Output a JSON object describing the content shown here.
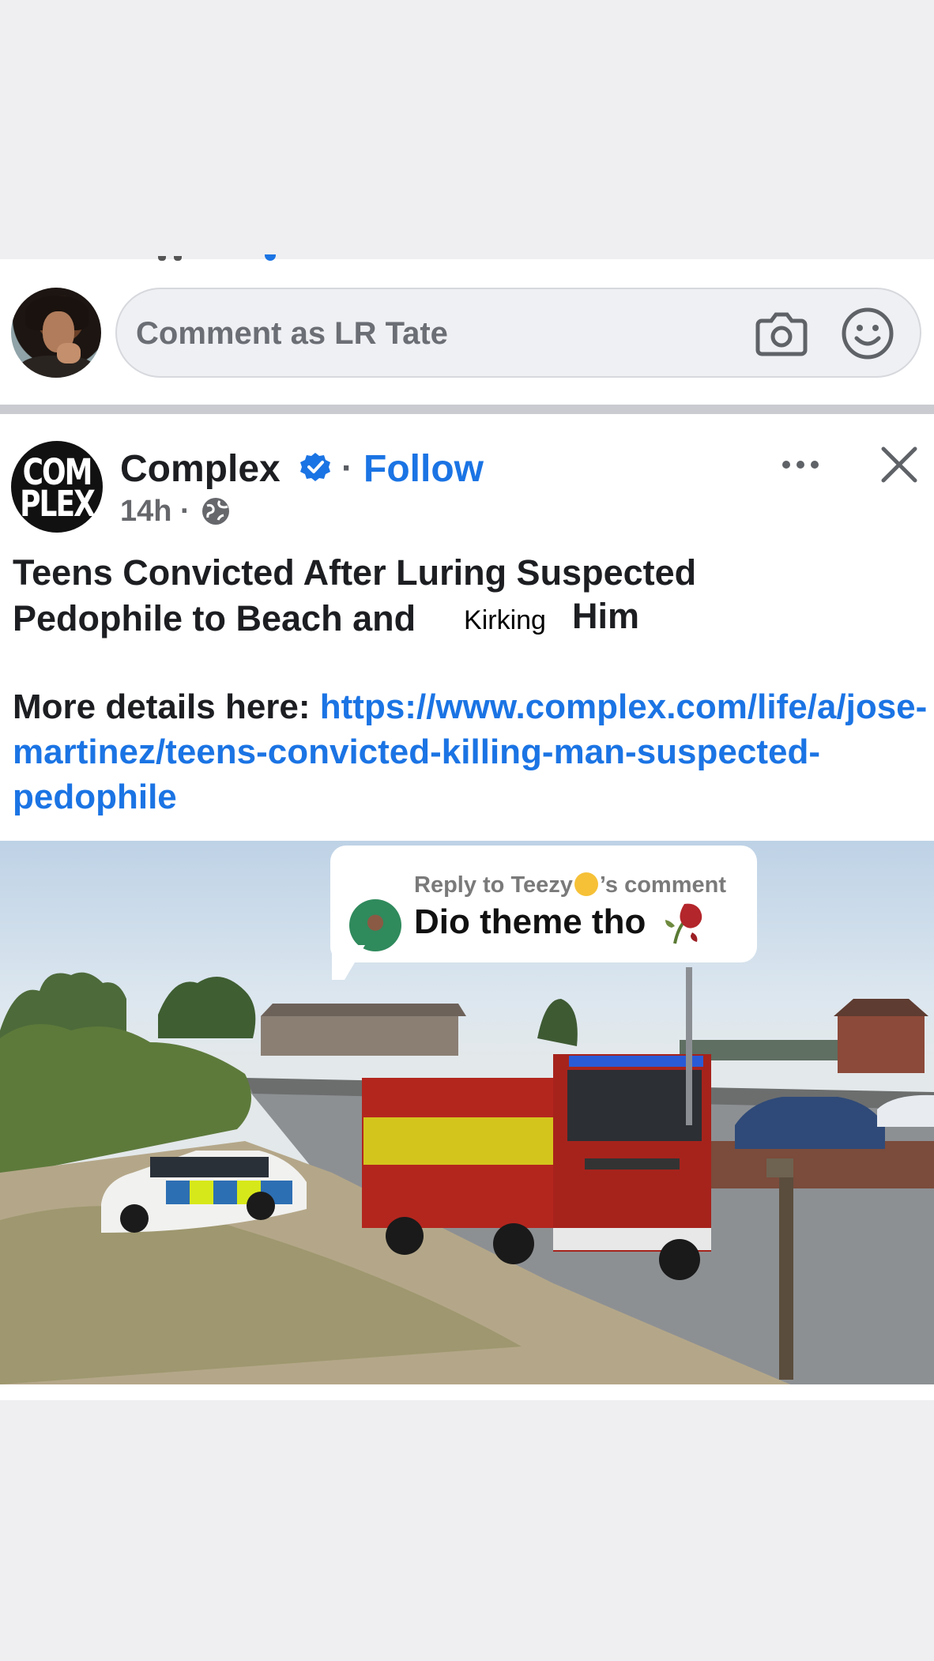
{
  "composer": {
    "placeholder": "Comment as LR Tate"
  },
  "post": {
    "page_name": "Complex",
    "avatar_text_line1": "COM",
    "avatar_text_line2": "PLEX",
    "separator": "·",
    "follow_label": "Follow",
    "time": "14h ·",
    "headline_line1": "Teens Convicted After Luring Suspected",
    "headline_line2": "Pedophile to Beach and",
    "sticker_word": "Kirking",
    "headline_end": "Him",
    "details_label": "More details here: ",
    "details_link": "https://www.complex.com/life/a/jose-martinez/teens-convicted-killing-man-suspected-pedophile"
  },
  "reply_card": {
    "label_prefix": "Reply to Teezy",
    "label_suffix": "’s comment",
    "text": "Dio theme tho"
  },
  "colors": {
    "accent": "#1b74e4",
    "text": "#1c1e21",
    "secondary": "#65676b",
    "background": "#efeff2"
  },
  "icons": [
    "camera-icon",
    "smile-icon",
    "verified-icon",
    "globe-icon",
    "more-icon",
    "close-icon",
    "rose-icon"
  ]
}
